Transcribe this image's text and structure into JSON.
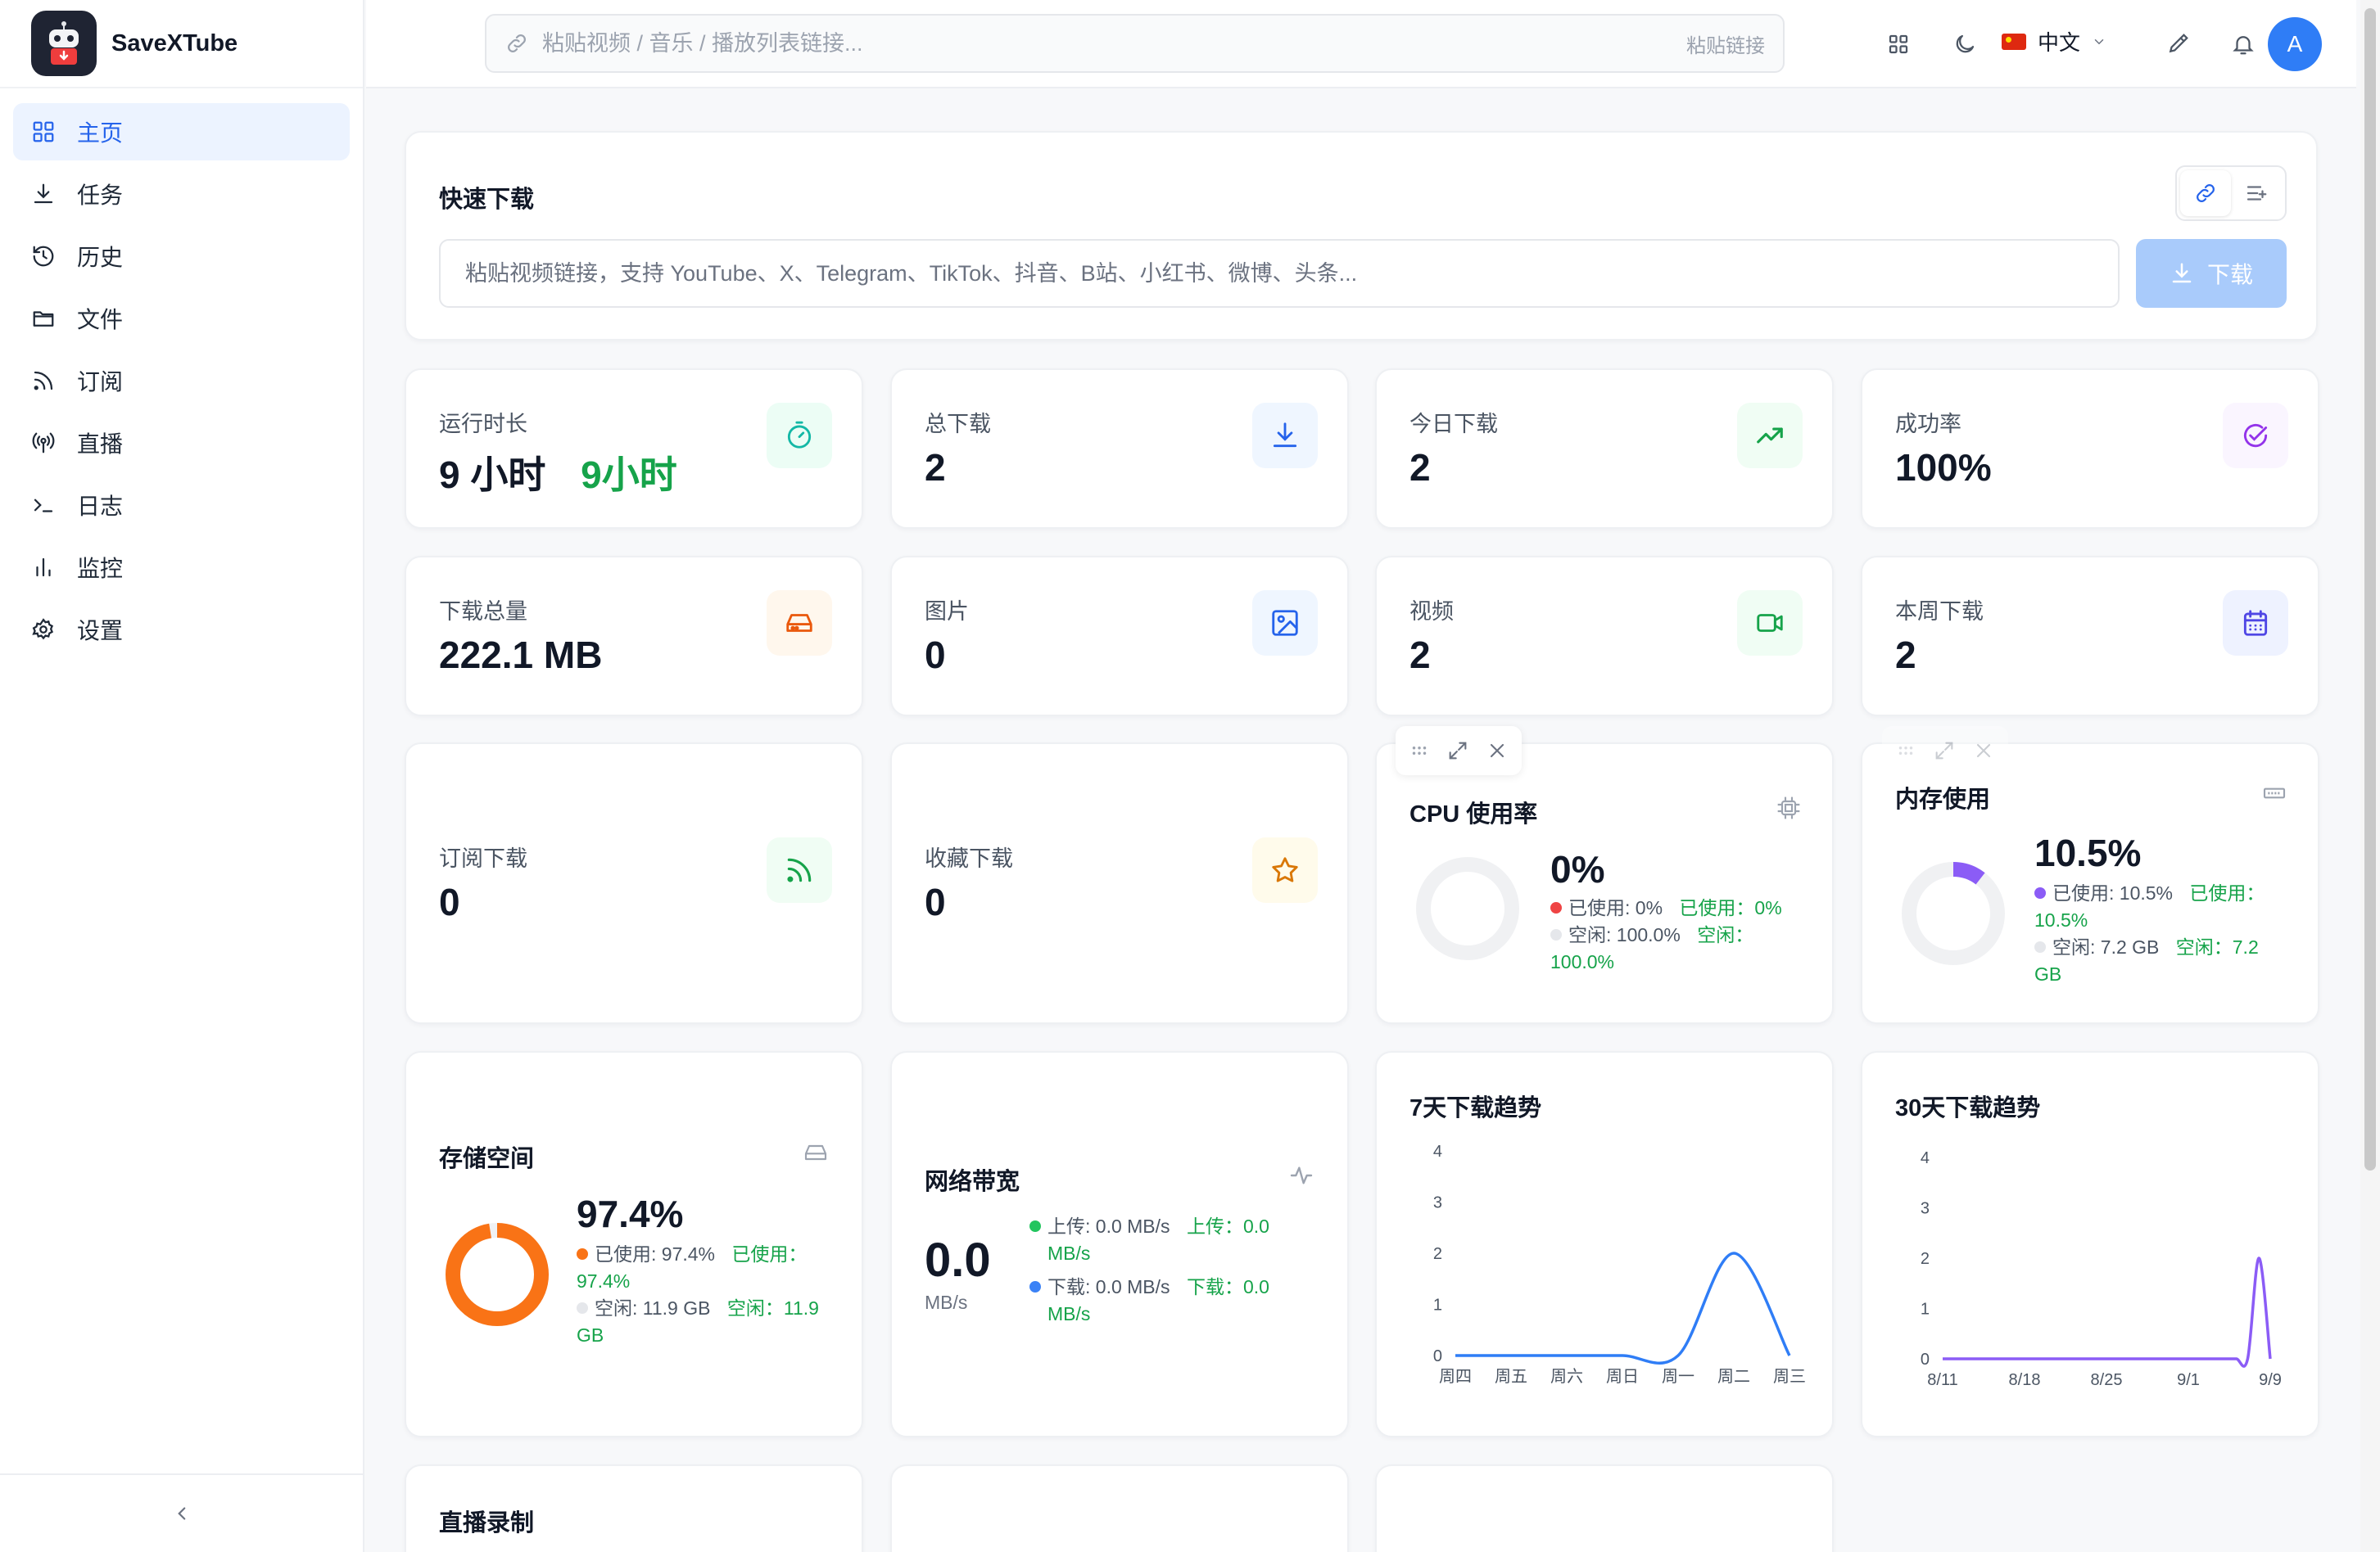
{
  "app": {
    "name": "SaveXTube"
  },
  "sidebar": {
    "items": [
      {
        "label": "主页",
        "icon": "grid-icon",
        "active": true
      },
      {
        "label": "任务",
        "icon": "download-icon",
        "active": false
      },
      {
        "label": "历史",
        "icon": "history-icon",
        "active": false
      },
      {
        "label": "文件",
        "icon": "folder-icon",
        "active": false
      },
      {
        "label": "订阅",
        "icon": "rss-icon",
        "active": false
      },
      {
        "label": "直播",
        "icon": "broadcast-icon",
        "active": false
      },
      {
        "label": "日志",
        "icon": "terminal-icon",
        "active": false
      },
      {
        "label": "监控",
        "icon": "bar-chart-icon",
        "active": false
      },
      {
        "label": "设置",
        "icon": "gear-icon",
        "active": false
      }
    ],
    "collapse_icon": "chevron-left-icon"
  },
  "header": {
    "url_placeholder": "粘贴视频 / 音乐 / 播放列表链接...",
    "paste_label": "粘贴链接",
    "language": "中文",
    "avatar_initial": "A"
  },
  "quick_download": {
    "title": "快速下载",
    "placeholder": "粘贴视频链接，支持 YouTube、X、Telegram、TikTok、抖音、B站、小红书、微博、头条...",
    "button_label": "下载"
  },
  "stats": [
    {
      "label": "运行时长",
      "value": "9 小时",
      "extra": "9小时",
      "icon": "timer-icon",
      "color": "#14b8a6",
      "bg": "#ecfdf5"
    },
    {
      "label": "总下载",
      "value": "2",
      "icon": "download-icon",
      "color": "#2563eb",
      "bg": "#eff6ff"
    },
    {
      "label": "今日下载",
      "value": "2",
      "icon": "trending-up-icon",
      "color": "#16a34a",
      "bg": "#f0fdf4"
    },
    {
      "label": "成功率",
      "value": "100%",
      "icon": "check-circle-icon",
      "color": "#9333ea",
      "bg": "#faf5ff"
    },
    {
      "label": "下载总量",
      "value": "222.1 MB",
      "icon": "hard-drive-icon",
      "color": "#ea580c",
      "bg": "#fff7ed"
    },
    {
      "label": "图片",
      "value": "0",
      "icon": "image-icon",
      "color": "#2563eb",
      "bg": "#eff6ff"
    },
    {
      "label": "视频",
      "value": "2",
      "icon": "video-icon",
      "color": "#16a34a",
      "bg": "#f0fdf4"
    },
    {
      "label": "本周下载",
      "value": "2",
      "icon": "calendar-icon",
      "color": "#4f46e5",
      "bg": "#eef2ff"
    },
    {
      "label": "订阅下载",
      "value": "0",
      "icon": "rss-icon",
      "color": "#16a34a",
      "bg": "#f0fdf4"
    },
    {
      "label": "收藏下载",
      "value": "0",
      "icon": "star-icon",
      "color": "#d97706",
      "bg": "#fffbeb"
    }
  ],
  "cpu": {
    "title": "CPU 使用率",
    "percent": "0%",
    "used_fraction": 0,
    "used_text": "已使用: 0%",
    "used_text_alt": "已使用：0%",
    "free_text": "空闲: 100.0%",
    "free_text_alt": "空闲：",
    "free_text_alt2": "100.0%",
    "used_color": "#ef4444"
  },
  "memory": {
    "title": "内存使用",
    "percent": "10.5%",
    "used_fraction": 0.105,
    "used_text": "已使用: 10.5%",
    "used_text_alt": "已使用：",
    "used_text_alt2": "10.5%",
    "free_text": "空闲: 7.2 GB",
    "free_text_alt": "空闲：7.2",
    "free_text_alt2": "GB",
    "used_color": "#8b5cf6"
  },
  "storage": {
    "title": "存储空间",
    "percent": "97.4%",
    "used_fraction": 0.974,
    "used_text": "已使用: 97.4%",
    "used_text_alt": "已使用：",
    "used_text_alt2": "97.4%",
    "free_text": "空闲: 11.9 GB",
    "free_text_alt": "空闲：11.9",
    "free_text_alt2": "GB",
    "used_color": "#f97316"
  },
  "network": {
    "title": "网络带宽",
    "value": "0.0",
    "unit": "MB/s",
    "upload_text": "上传: 0.0 MB/s",
    "upload_alt": "上传：0.0",
    "upload_alt2": "MB/s",
    "download_text": "下载: 0.0 MB/s",
    "download_alt": "下载：0.0",
    "download_alt2": "MB/s",
    "upload_color": "#22c55e",
    "download_color": "#3b82f6"
  },
  "live_recording": {
    "title": "直播录制"
  },
  "chart_data": [
    {
      "type": "line",
      "title": "7天下载趋势",
      "x": [
        "周四",
        "周五",
        "周六",
        "周日",
        "周一",
        "周二",
        "周三"
      ],
      "values": [
        0,
        0,
        0,
        0,
        0,
        2,
        0
      ],
      "ylim": [
        0,
        4
      ],
      "yticks": [
        0,
        1,
        2,
        3,
        4
      ],
      "color": "#2f7df6"
    },
    {
      "type": "line",
      "title": "30天下载趋势",
      "x_labels": [
        "8/11",
        "8/18",
        "8/25",
        "9/1",
        "9/9"
      ],
      "points": 30,
      "values": [
        0,
        0,
        0,
        0,
        0,
        0,
        0,
        0,
        0,
        0,
        0,
        0,
        0,
        0,
        0,
        0,
        0,
        0,
        0,
        0,
        0,
        0,
        0,
        0,
        0,
        0,
        0,
        0,
        2,
        0
      ],
      "ylim": [
        0,
        4
      ],
      "yticks": [
        0,
        1,
        2,
        3,
        4
      ],
      "color": "#8b5cf6"
    }
  ]
}
